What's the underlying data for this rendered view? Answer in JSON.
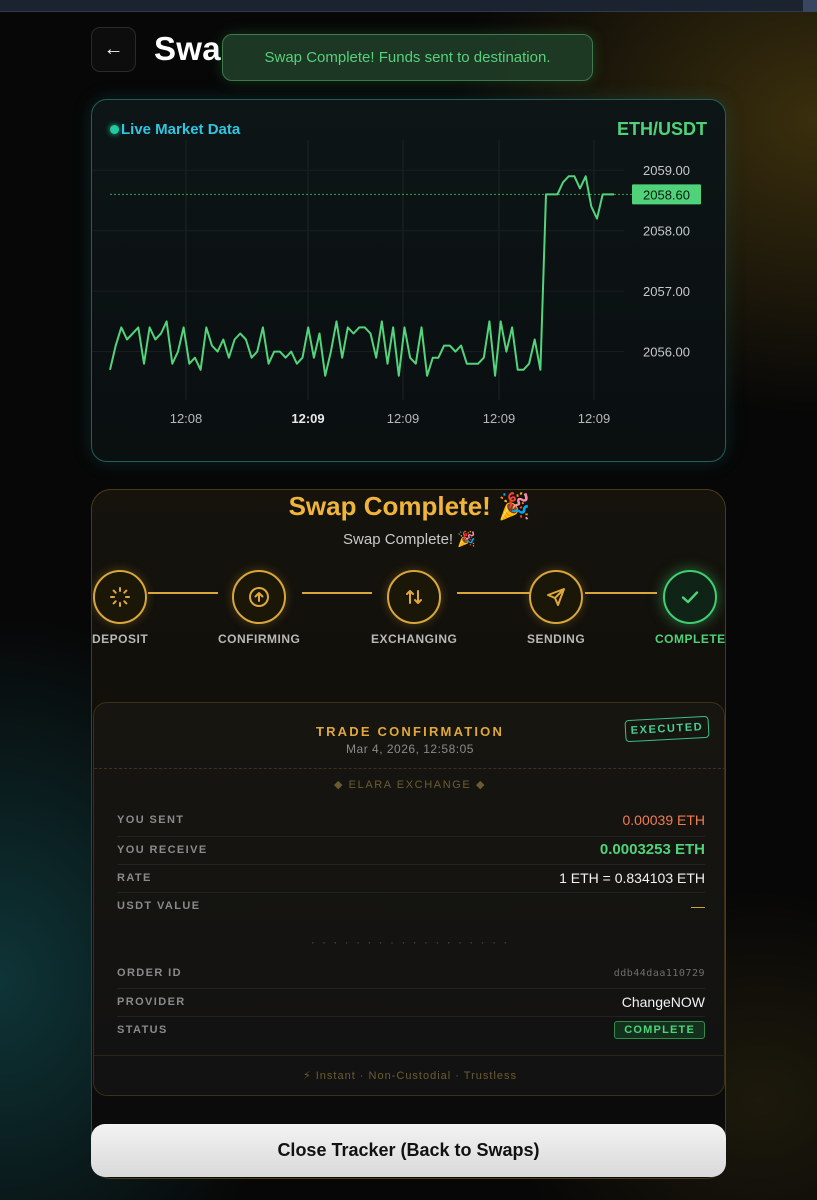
{
  "header": {
    "back_label": "←",
    "title": "Swa"
  },
  "toast": {
    "message": "Swap Complete! Funds sent to destination."
  },
  "market": {
    "live_label": "Live Market Data",
    "pair": "ETH/USDT",
    "current_price_label": "2058.60"
  },
  "chart_data": {
    "type": "line",
    "title": "",
    "xlabel": "",
    "ylabel": "",
    "ylim": [
      2055.2,
      2059.5
    ],
    "yticks": [
      2059.0,
      2058.0,
      2057.0,
      2056.0
    ],
    "ytick_labels": [
      "2059.00",
      "2058.00",
      "2057.00",
      "2056.00"
    ],
    "xtick_labels": [
      "12:08",
      "12:09",
      "12:09",
      "12:09",
      "12:09"
    ],
    "xtick_bold": [
      false,
      true,
      false,
      false,
      false
    ],
    "current_price": 2058.6,
    "grid": true,
    "series": [
      {
        "values": [
          2055.7,
          2056.1,
          2056.4,
          2056.2,
          2056.3,
          2056.4,
          2055.8,
          2056.4,
          2056.2,
          2056.3,
          2056.5,
          2055.8,
          2056.0,
          2056.4,
          2055.8,
          2055.9,
          2055.7,
          2056.4,
          2056.1,
          2056.0,
          2056.2,
          2055.9,
          2056.2,
          2056.3,
          2056.2,
          2055.9,
          2056.0,
          2056.4,
          2055.8,
          2056.0,
          2056.0,
          2055.9,
          2056.0,
          2055.8,
          2055.9,
          2056.4,
          2055.9,
          2056.3,
          2055.6,
          2056.0,
          2056.5,
          2055.9,
          2056.4,
          2056.3,
          2056.4,
          2056.4,
          2056.3,
          2055.9,
          2056.5,
          2055.8,
          2056.4,
          2055.6,
          2056.4,
          2055.9,
          2055.8,
          2056.4,
          2055.6,
          2055.9,
          2055.9,
          2056.1,
          2056.1,
          2056.0,
          2056.1,
          2055.8,
          2055.8,
          2055.8,
          2055.9,
          2056.5,
          2055.6,
          2056.5,
          2056.0,
          2056.4,
          2055.7,
          2055.7,
          2055.8,
          2056.2,
          2055.7,
          2058.6,
          2058.6,
          2058.6,
          2058.8,
          2058.9,
          2058.9,
          2058.7,
          2058.9,
          2058.4,
          2058.2,
          2058.6,
          2058.6,
          2058.6
        ]
      }
    ]
  },
  "tracker": {
    "title": "Swap Complete! 🎉",
    "subtitle": "Swap Complete! 🎉",
    "steps": [
      {
        "label": "DEPOSIT",
        "state": "active"
      },
      {
        "label": "CONFIRMING",
        "state": "active"
      },
      {
        "label": "EXCHANGING",
        "state": "active"
      },
      {
        "label": "SENDING",
        "state": "active"
      },
      {
        "label": "COMPLETE",
        "state": "done"
      }
    ],
    "colors": {
      "gold": "#d9a63a",
      "green": "#3fcf70",
      "orange": "#f07c52"
    }
  },
  "confirmation": {
    "title": "TRADE CONFIRMATION",
    "date": "Mar 4, 2026, 12:58:05",
    "stamp": "EXECUTED",
    "brand": "◆ ELARA EXCHANGE ◆",
    "you_sent_label": "YOU SENT",
    "you_sent_value": "0.00039 ETH",
    "you_receive_label": "YOU RECEIVE",
    "you_receive_value": "0.0003253 ETH",
    "rate_label": "RATE",
    "rate_value": "1 ETH = 0.834103 ETH",
    "usdt_label": "USDT VALUE",
    "usdt_value": "—",
    "dots": "· · · · · · · · · · · · · · · · · ·",
    "order_id_label": "ORDER ID",
    "order_id_value": "ddb44daa110729",
    "provider_label": "PROVIDER",
    "provider_value": "ChangeNOW",
    "status_label": "STATUS",
    "status_value": "COMPLETE",
    "footer": "⚡ Instant · Non-Custodial · Trustless"
  },
  "close_button": {
    "label": "Close Tracker (Back to Swaps)"
  }
}
